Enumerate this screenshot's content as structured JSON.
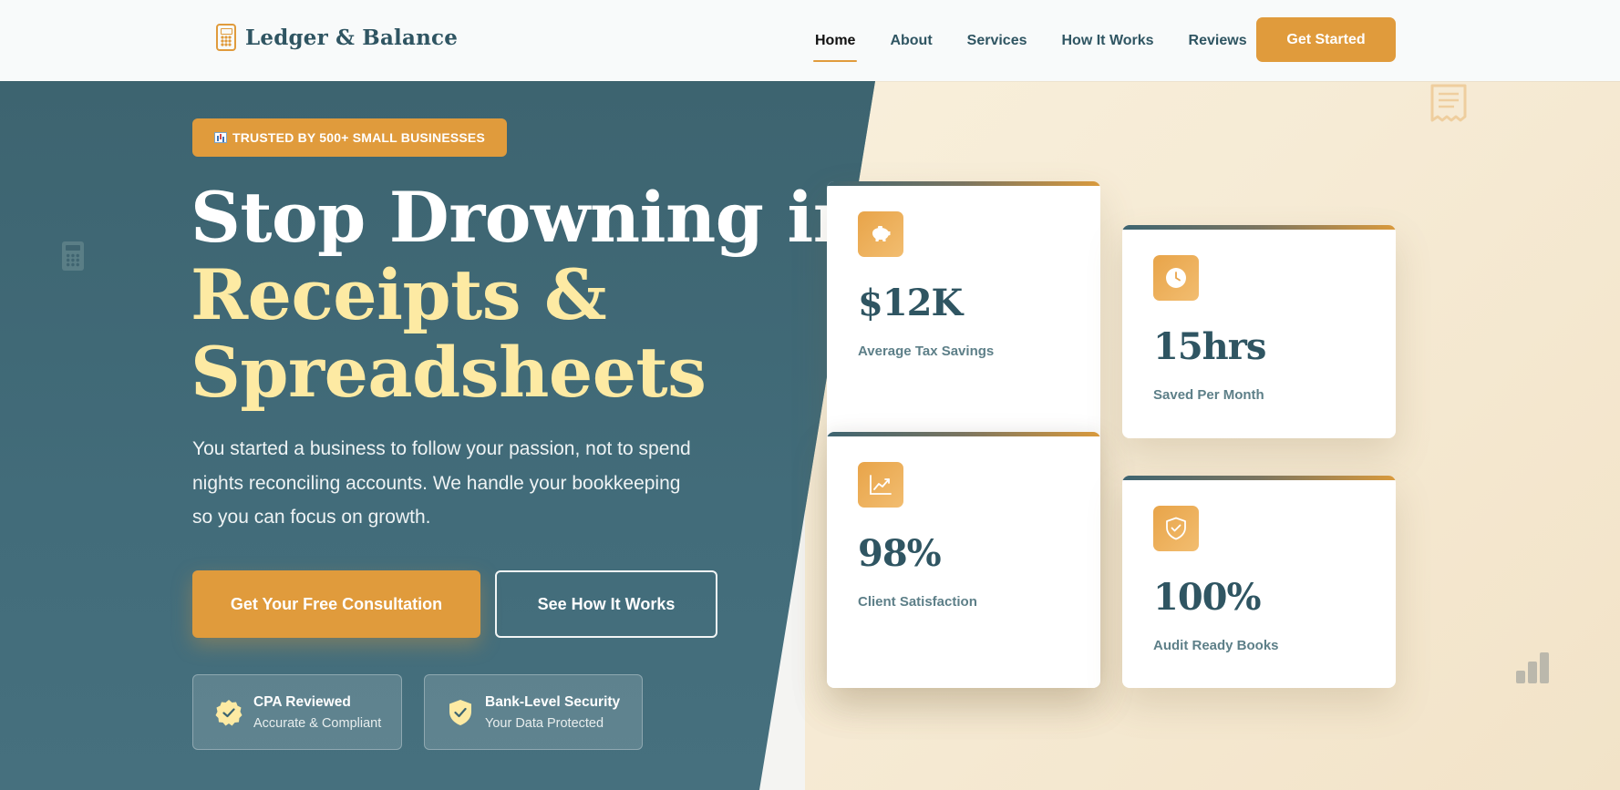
{
  "brand": {
    "name": "Ledger & Balance",
    "icon": "calculator-icon",
    "accent": "#e09b3c",
    "primary": "#2f5562"
  },
  "nav": {
    "links": [
      {
        "label": "Home",
        "active": true
      },
      {
        "label": "About"
      },
      {
        "label": "Services"
      },
      {
        "label": "How It Works"
      },
      {
        "label": "Reviews"
      }
    ],
    "cta": "Get Started"
  },
  "hero": {
    "badge": {
      "icon": "bar-chart-emoji-icon",
      "text": "TRUSTED BY 500+ SMALL BUSINESSES"
    },
    "headline_line1": "Stop Drowning in",
    "headline_line2": "Receipts &",
    "headline_line3": "Spreadsheets",
    "subtext": "You started a business to follow your passion, not to spend nights reconciling accounts. We handle your bookkeeping so you can focus on growth.",
    "primary_button": "Get Your Free Consultation",
    "secondary_button": "See How It Works",
    "trust": [
      {
        "icon": "check-seal-icon",
        "title": "CPA Reviewed",
        "subtitle": "Accurate & Compliant"
      },
      {
        "icon": "shield-check-icon",
        "title": "Bank-Level Security",
        "subtitle": "Your Data Protected"
      }
    ]
  },
  "stats": [
    {
      "icon": "piggy-bank-icon",
      "value": "$12K",
      "label": "Average Tax Savings"
    },
    {
      "icon": "clock-icon",
      "value": "15hrs",
      "label": "Saved Per Month"
    },
    {
      "icon": "trend-chart-icon",
      "value": "98%",
      "label": "Client Satisfaction"
    },
    {
      "icon": "shield-check-icon",
      "value": "100%",
      "label": "Audit Ready Books"
    }
  ]
}
